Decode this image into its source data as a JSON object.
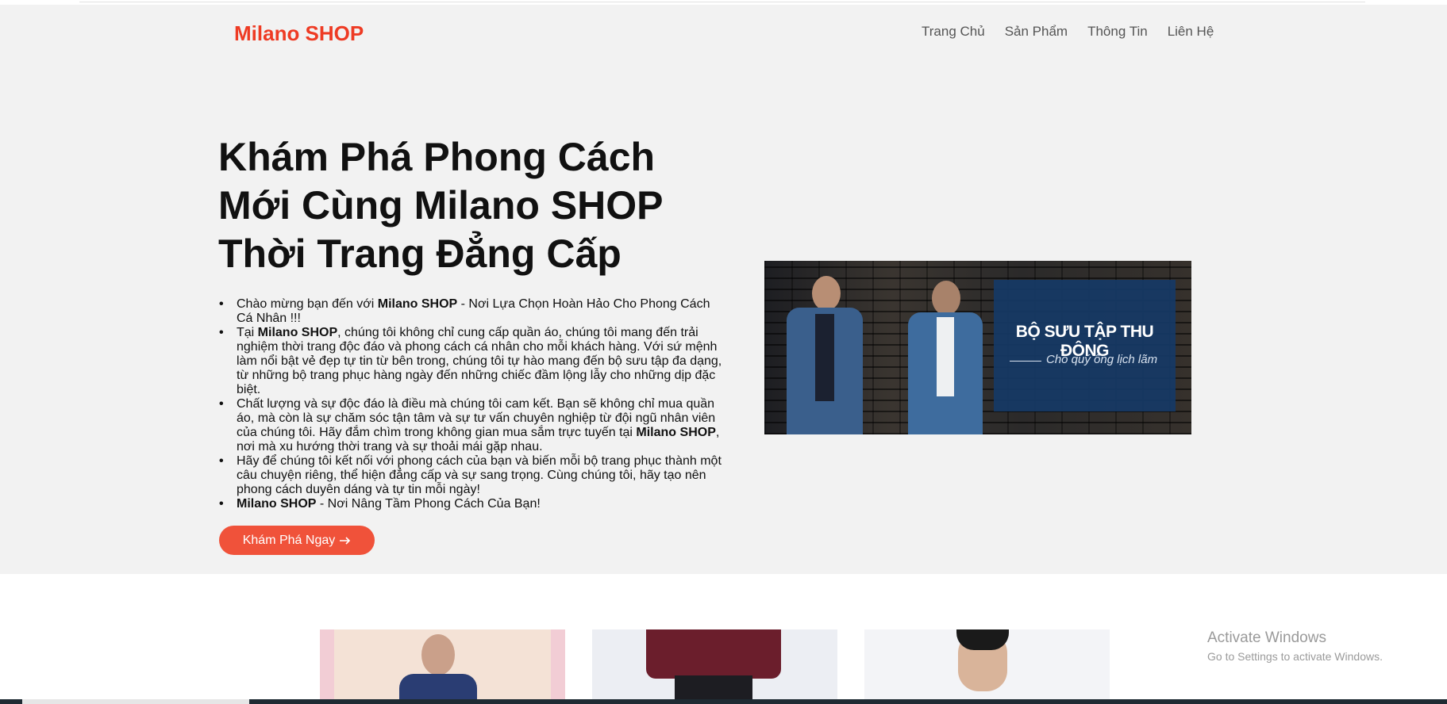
{
  "header": {
    "logo": "Milano SHOP",
    "nav": [
      "Trang Chủ",
      "Sản Phẩm",
      "Thông Tin",
      "Liên Hệ"
    ]
  },
  "hero": {
    "headline": "Khám Phá Phong Cách Mới Cùng Milano SHOP Thời Trang Đẳng Cấp",
    "intro": [
      {
        "pre": "Chào mừng bạn đến với ",
        "bold": "Milano SHOP",
        "post": " - Nơi Lựa Chọn Hoàn Hảo Cho Phong Cách Cá Nhân !!!"
      },
      {
        "pre": "Tại ",
        "bold": "Milano SHOP",
        "post": ", chúng tôi không chỉ cung cấp quần áo, chúng tôi mang đến trải nghiệm thời trang độc đáo và phong cách cá nhân cho mỗi khách hàng. Với sứ mệnh làm nổi bật vẻ đẹp tự tin từ bên trong, chúng tôi tự hào mang đến bộ sưu tập đa dạng, từ những bộ trang phục hàng ngày đến những chiếc đầm lộng lẫy cho những dịp đặc biệt."
      },
      {
        "pre": "Chất lượng và sự độc đáo là điều mà chúng tôi cam kết. Bạn sẽ không chỉ mua quần áo, mà còn là sự chăm sóc tận tâm và sự tư vấn chuyên nghiệp từ đội ngũ nhân viên của chúng tôi. Hãy đắm chìm trong không gian mua sắm trực tuyến tại ",
        "bold": "Milano SHOP",
        "post": ", nơi mà xu hướng thời trang và sự thoải mái gặp nhau."
      },
      {
        "pre": "Hãy để chúng tôi kết nối với phong cách của bạn và biến mỗi bộ trang phục thành một câu chuyện riêng, thể hiện đẳng cấp và sự sang trọng. Cùng chúng tôi, hãy tạo nên phong cách duyên dáng và tự tin mỗi ngày!",
        "bold": "",
        "post": ""
      },
      {
        "pre": "",
        "bold": "Milano SHOP",
        "post": " - Nơi Nâng Tầm Phong Cách Của Bạn!"
      }
    ],
    "cta_label": "Khám Phá Ngay",
    "cta_icon": "arrow-right-icon"
  },
  "banner": {
    "title": "BỘ SƯU TẬP THU ĐÔNG",
    "subtitle": "Cho quý ông lịch lãm"
  },
  "watermark": {
    "title": "Activate Windows",
    "subtitle": "Go to Settings to activate Windows."
  },
  "colors": {
    "accent": "#ee3b24",
    "button": "#f0523a",
    "hero_bg": "#f2f2f2",
    "banner_panel": "#163a66"
  }
}
